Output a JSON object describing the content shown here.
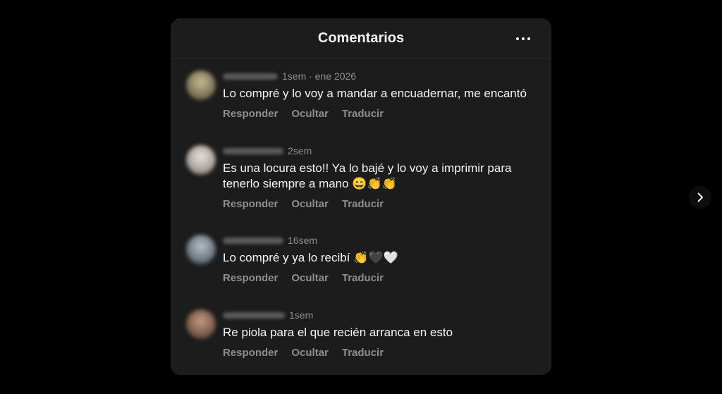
{
  "header": {
    "title": "Comentarios",
    "more_icon": "more-horizontal-icon"
  },
  "comments": [
    {
      "time": "1sem · ene 2026",
      "text": "Lo compré y lo voy a mandar a encuadernar, me encantó",
      "avatar_color": "#9a8f6e",
      "actions": [
        "Responder",
        "Ocultar",
        "Traducir"
      ]
    },
    {
      "time": "2sem",
      "text": "Es una locura esto!! Ya lo bajé y lo voy a imprimir para tenerlo siempre a mano 😄👏👏",
      "avatar_color": "#c9c2bd",
      "actions": [
        "Responder",
        "Ocultar",
        "Traducir"
      ]
    },
    {
      "time": "16sem",
      "text": "Lo compré y ya lo recibí 👏🖤🤍",
      "avatar_color": "#8c95a0",
      "actions": [
        "Responder",
        "Ocultar",
        "Traducir"
      ]
    },
    {
      "time": "1sem",
      "text": "Re piola para el que recién arranca en esto",
      "avatar_color": "#8a6a55",
      "actions": [
        "Responder",
        "Ocultar",
        "Traducir"
      ]
    }
  ],
  "navigation": {
    "next_icon": "chevron-right-icon"
  }
}
